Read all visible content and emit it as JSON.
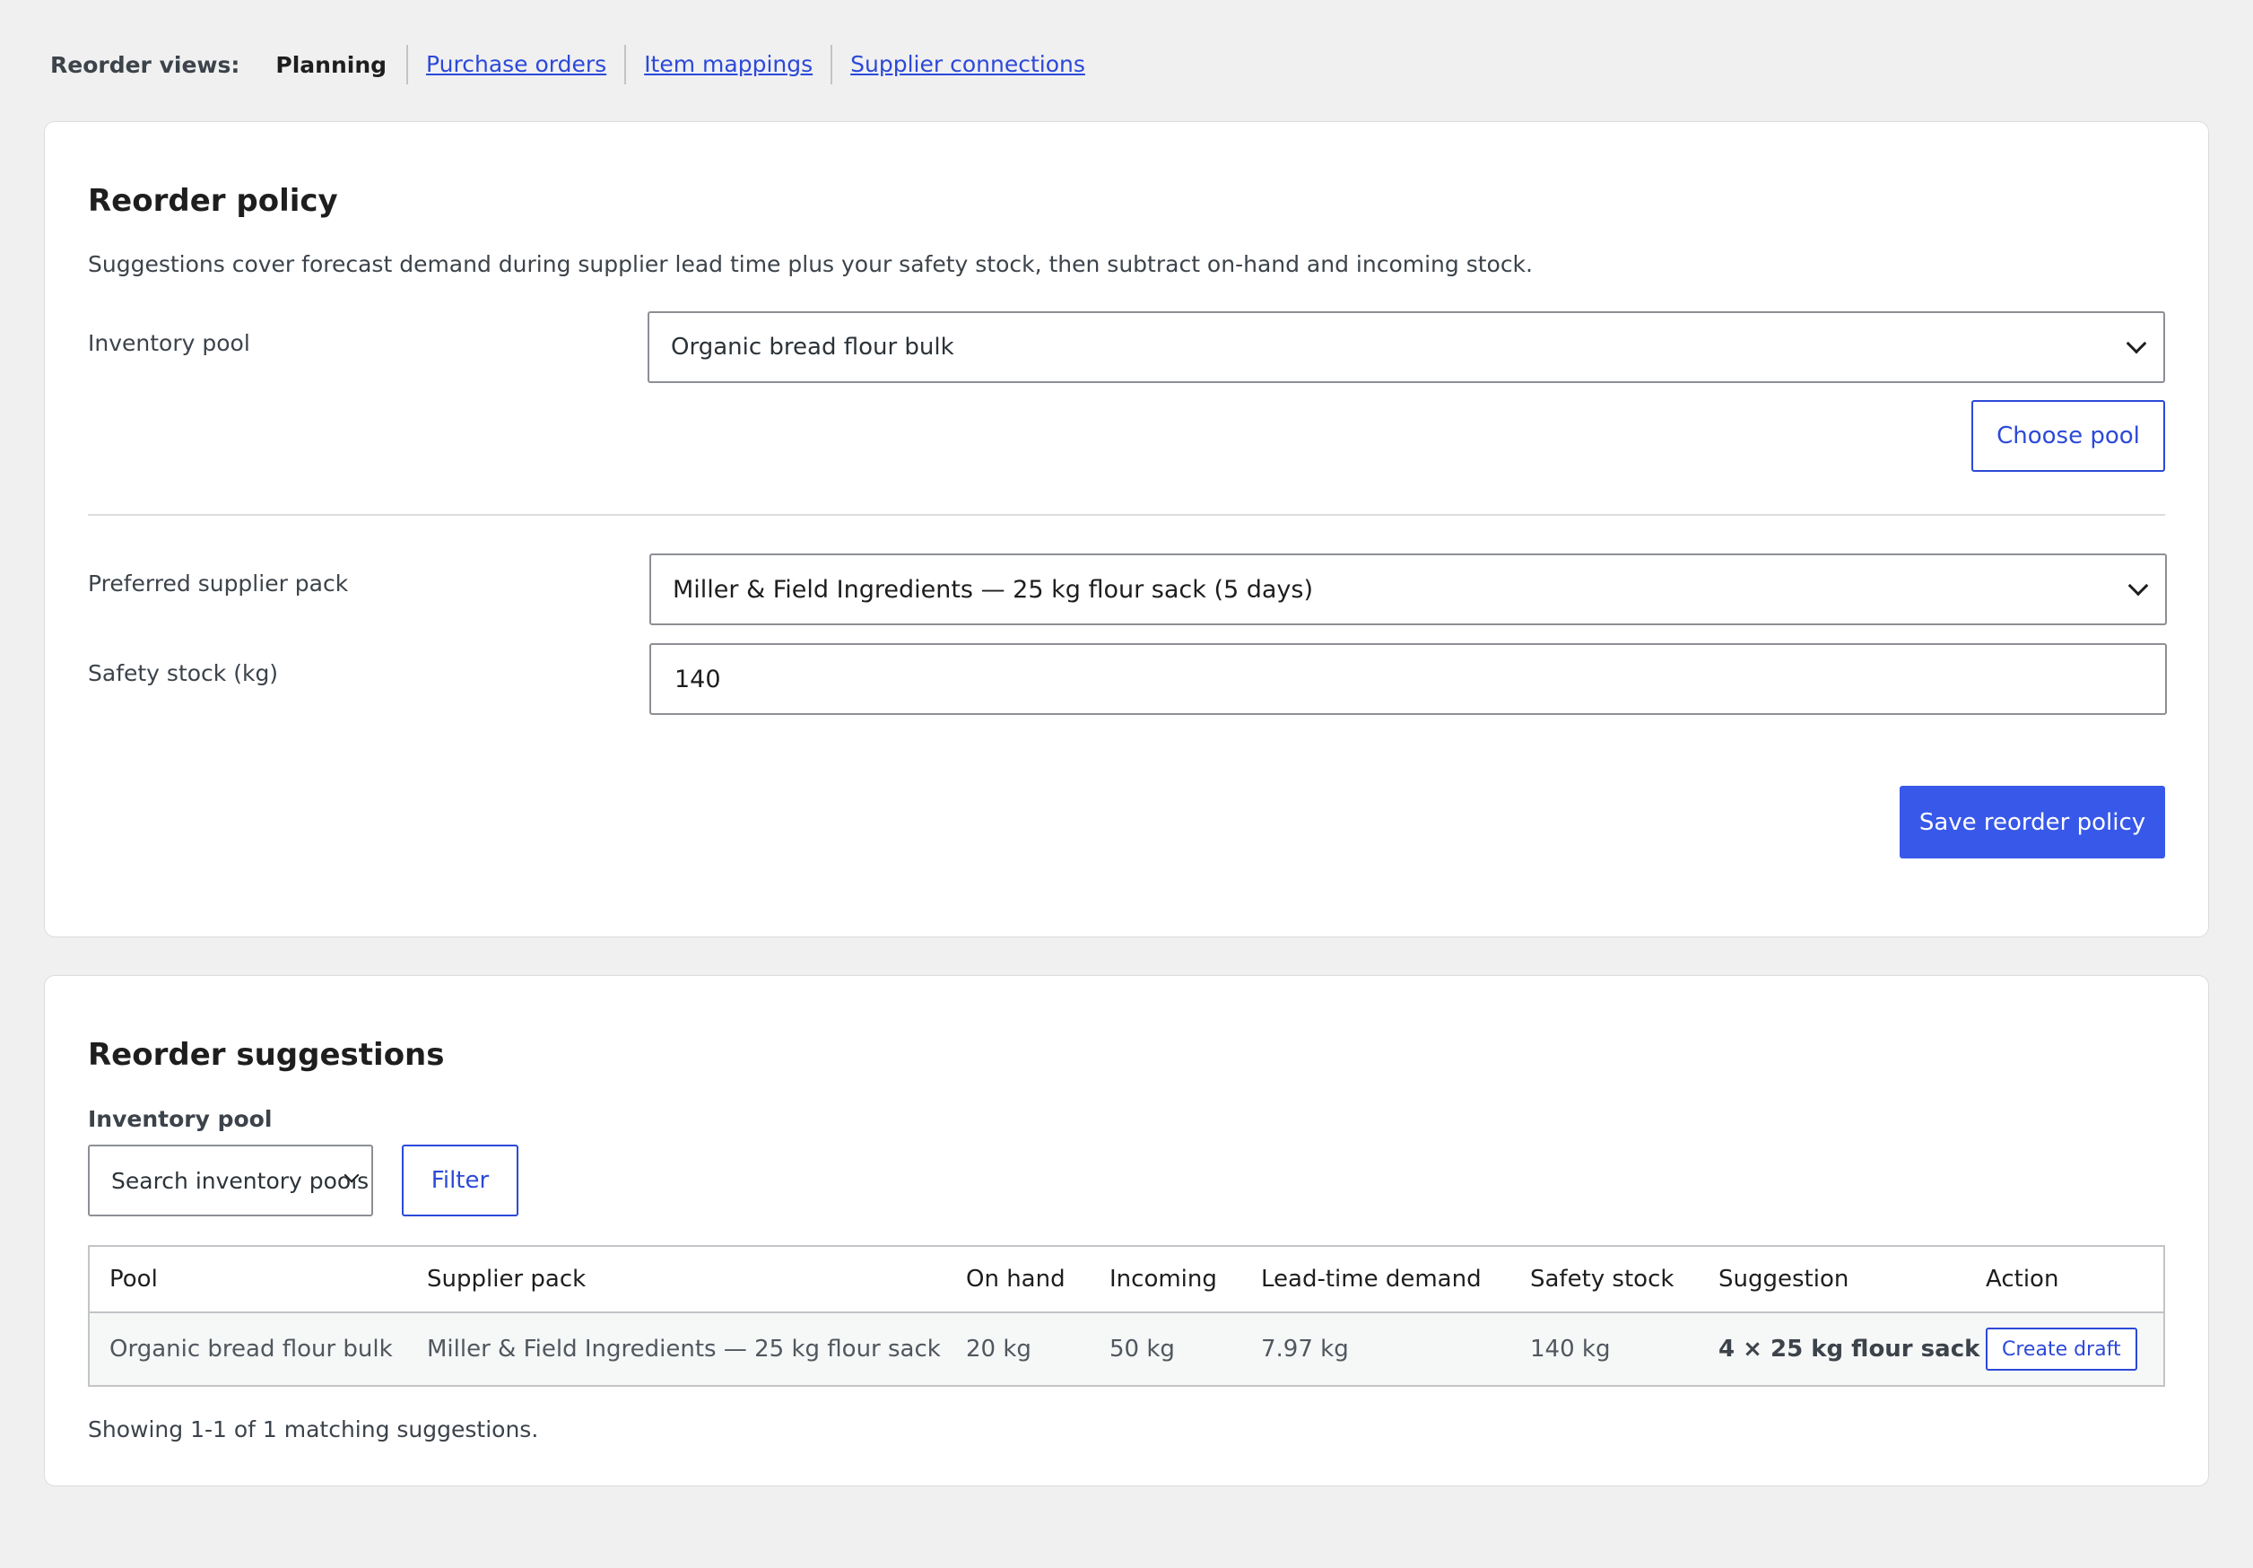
{
  "views": {
    "label": "Reorder views:",
    "current": "Planning",
    "links": [
      "Purchase orders",
      "Item mappings",
      "Supplier connections"
    ]
  },
  "policy": {
    "title": "Reorder policy",
    "description": "Suggestions cover forecast demand during supplier lead time plus your safety stock, then subtract on-hand and incoming stock.",
    "inventory_pool_label": "Inventory pool",
    "inventory_pool_value": "Organic bread flour bulk",
    "choose_pool_button": "Choose pool",
    "supplier_pack_label": "Preferred supplier pack",
    "supplier_pack_value": "Miller & Field Ingredients — 25 kg flour sack (5 days)",
    "safety_stock_label": "Safety stock (kg)",
    "safety_stock_value": "140",
    "save_button": "Save reorder policy"
  },
  "suggestions": {
    "title": "Reorder suggestions",
    "filter_label": "Inventory pool",
    "search_placeholder": "Search inventory pools",
    "filter_button": "Filter",
    "columns": [
      "Pool",
      "Supplier pack",
      "On hand",
      "Incoming",
      "Lead-time demand",
      "Safety stock",
      "Suggestion",
      "Action"
    ],
    "rows": [
      {
        "pool": "Organic bread flour bulk",
        "supplier_pack": "Miller & Field Ingredients — 25 kg flour sack",
        "on_hand": "20 kg",
        "incoming": "50 kg",
        "lead_time_demand": "7.97 kg",
        "safety_stock": "140 kg",
        "suggestion": "4 × 25 kg flour sack",
        "action": "Create draft"
      }
    ],
    "footer": "Showing 1-1 of 1 matching suggestions."
  },
  "colors": {
    "accent": "#3858e9",
    "link": "#2c49d8",
    "background": "#f0f0f1"
  }
}
